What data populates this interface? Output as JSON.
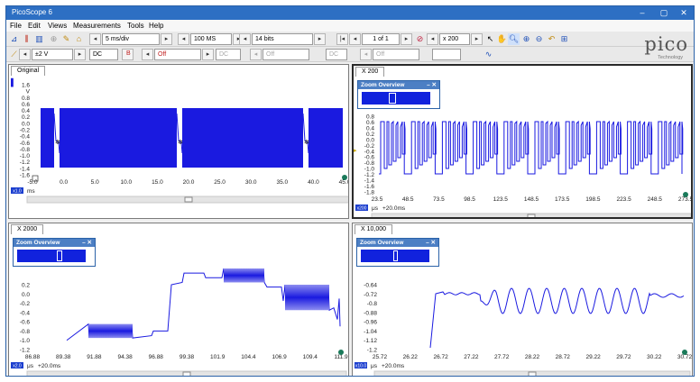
{
  "app": {
    "title": "PicoScope 6"
  },
  "menu": [
    "File",
    "Edit",
    "Views",
    "Measurements",
    "Tools",
    "Help"
  ],
  "window_controls": [
    "–",
    "▢",
    "✕"
  ],
  "toolbar1": {
    "timebase": "5 ms/div",
    "samples": "100 MS",
    "resolution": "14 bits",
    "page": "1 of 1",
    "zoom": "x 200"
  },
  "toolbar2": {
    "chA_range": "±2 V",
    "chA_coupling": "DC",
    "chB_label": "B",
    "chB_state": "Off",
    "chB_coupling": "DC",
    "dis1": "Off",
    "dis2": "DC",
    "dis3": "Off"
  },
  "logo": {
    "brand": "pico",
    "sub": "Technology"
  },
  "colors": {
    "trace": "#1a1ae0",
    "titlebar": "#2d6fc3",
    "unit_box": "#1c3fcf"
  },
  "panes": [
    {
      "tab": "Original",
      "y_ticks": [
        "1.6",
        "V",
        "0.8",
        "0.6",
        "0.4",
        "0.2",
        "0.0",
        "-0.2",
        "-0.4",
        "-0.6",
        "-0.8",
        "-1.0",
        "-1.2",
        "-1.4",
        "-1.6"
      ],
      "x_ticks": [
        "-5.0",
        "0.0",
        "5.0",
        "10.0",
        "15.0",
        "20.0",
        "25.0",
        "30.0",
        "35.0",
        "40.0",
        "45.0"
      ],
      "unit_box": "x1.0",
      "unit": "ms",
      "offset": ""
    },
    {
      "tab": "X 200",
      "y_ticks": [
        "0.8",
        "0.6",
        "0.4",
        "0.2",
        "0.0",
        "-0.2",
        "-0.4",
        "-0.6",
        "-0.8",
        "-1.0",
        "-1.2",
        "-1.4",
        "-1.6",
        "-1.8"
      ],
      "x_ticks": [
        "23.5",
        "48.5",
        "73.5",
        "98.5",
        "123.5",
        "148.5",
        "173.5",
        "198.5",
        "223.5",
        "248.5",
        "273.5"
      ],
      "unit_box": "x200",
      "unit": "μs",
      "offset": "+20.0ms",
      "zoom_overview": "Zoom Overview"
    },
    {
      "tab": "X 2000",
      "y_ticks": [
        "0.2",
        "0.0",
        "-0.2",
        "-0.4",
        "-0.6",
        "-0.8",
        "-1.0",
        "-1.2"
      ],
      "x_ticks": [
        "86.88",
        "89.38",
        "91.88",
        "94.38",
        "96.88",
        "99.38",
        "101.9",
        "104.4",
        "106.9",
        "109.4",
        "111.9"
      ],
      "unit_box": "x2.0",
      "unit": "μs",
      "offset": "+20.0ms",
      "zoom_overview": "Zoom Overview"
    },
    {
      "tab": "X 10,000",
      "y_ticks": [
        "-0.64",
        "-0.72",
        "-0.8",
        "-0.88",
        "-0.96",
        "-1.04",
        "-1.12",
        "-1.2"
      ],
      "x_ticks": [
        "25.72",
        "26.22",
        "26.72",
        "27.22",
        "27.72",
        "28.22",
        "28.72",
        "29.22",
        "29.72",
        "30.22",
        "30.72"
      ],
      "unit_box": "x10.0",
      "unit": "μs",
      "offset": "+20.0ms",
      "zoom_overview": "Zoom Overview"
    }
  ]
}
